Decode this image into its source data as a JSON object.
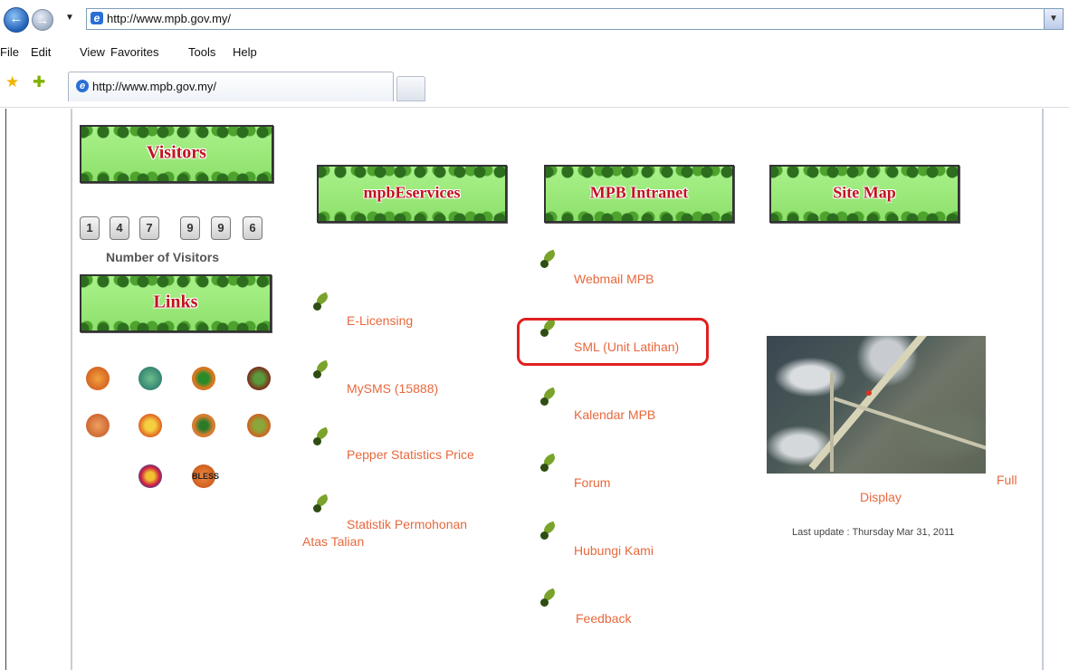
{
  "browser": {
    "address": "http://www.mpb.gov.my/",
    "tab_title": "http://www.mpb.gov.my/",
    "menu": [
      "File",
      "Edit",
      "View",
      "Favorites",
      "Tools",
      "Help"
    ]
  },
  "banners": {
    "visitors": "Visitors",
    "links": "Links",
    "eservices": "mpbEservices",
    "intranet": "MPB Intranet",
    "sitemap": "Site Map"
  },
  "counter": {
    "digits": [
      "1",
      "4",
      "7",
      "9",
      "9",
      "6"
    ],
    "label": "Number of Visitors"
  },
  "eservices": {
    "items": [
      "E-Licensing",
      "MySMS (15888)",
      "Pepper Statistics Price",
      "Statistik Permohonan",
      "Atas Talian"
    ]
  },
  "intranet": {
    "items": [
      "Webmail MPB",
      "SML (Unit Latihan)",
      "Kalendar MPB",
      "Forum",
      "Hubungi Kami",
      "Feedback"
    ]
  },
  "map": {
    "full": "Full",
    "display": "Display",
    "last_update": "Last update : Thursday Mar 31, 2011"
  },
  "logos": {
    "bless": "BLESS"
  },
  "colors": {
    "link": "#e8683d",
    "banner_text": "#c1121f",
    "highlight": "#e02020"
  }
}
